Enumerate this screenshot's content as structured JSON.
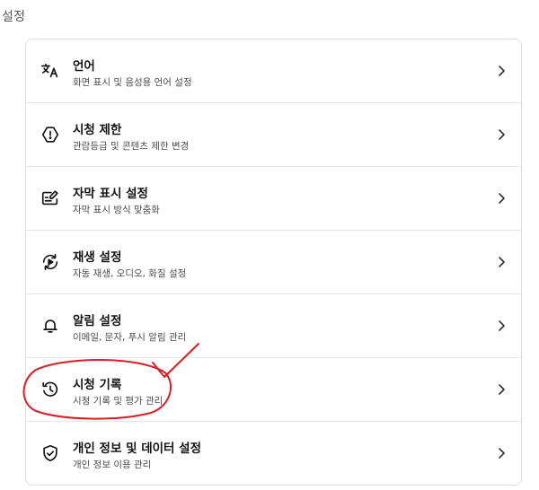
{
  "page": {
    "title": "설정"
  },
  "settings": {
    "items": [
      {
        "title": "언어",
        "description": "화면 표시 및 음성용 언어 설정",
        "icon": "translate-icon"
      },
      {
        "title": "시청 제한",
        "description": "관람등급 및 콘텐츠 제한 변경",
        "icon": "restriction-icon"
      },
      {
        "title": "자막 표시 설정",
        "description": "자막 표시 방식 맞춤화",
        "icon": "subtitles-edit-icon"
      },
      {
        "title": "재생 설정",
        "description": "자동 재생, 오디오, 화질 설정",
        "icon": "playback-cycle-icon"
      },
      {
        "title": "알림 설정",
        "description": "이메일, 문자, 푸시 알림 관리",
        "icon": "bell-icon"
      },
      {
        "title": "시청 기록",
        "description": "시청 기록 및 평가 관리",
        "icon": "history-clock-icon"
      },
      {
        "title": "개인 정보 및 데이터 설정",
        "description": "개인 정보 이용 관리",
        "icon": "shield-check-icon"
      }
    ]
  },
  "colors": {
    "annotation": "#d91f26",
    "border": "#dcdcdc",
    "text": "#141414",
    "subtext": "#4d4d4d"
  }
}
